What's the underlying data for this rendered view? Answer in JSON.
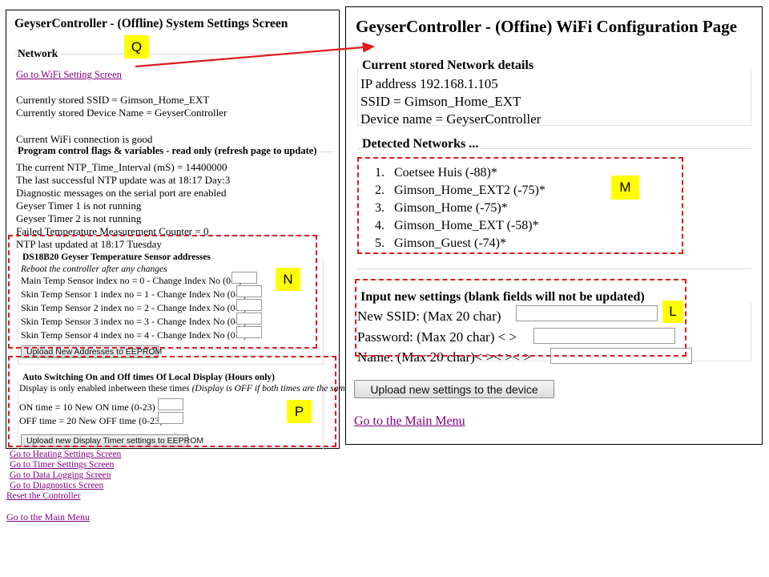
{
  "left_panel": {
    "title": "GeyserController - (Offline) System Settings Screen",
    "network_section": {
      "legend": "Network",
      "wifi_link": "Go to WiFi Setting Screen",
      "stored_ssid": "Currently stored SSID = Gimson_Home_EXT",
      "stored_device_name": "Currently stored Device Name = GeyserController",
      "connection_status": "Current WiFi connection is good"
    },
    "flags_section": {
      "legend": "Program control flags & variables - read only (refresh page to update)",
      "lines": [
        "The current NTP_Time_Interval (mS) = 14400000",
        "The last successful NTP update was at 18:17 Day:3",
        "Diagnostic messages on the serial port are enabled",
        "Geyser Timer 1 is not running",
        "Geyser Timer 2 is not running",
        "Failed Temperature Measurement Counter = 0",
        "NTP last updated at 18:17 Tuesday"
      ]
    },
    "sensor_section": {
      "legend": "DS18B20 Geyser Temperature Sensor addresses",
      "note": "Reboot the controller after any changes",
      "rows": [
        {
          "label": "Main Temp Sensor index no = 0 - Change Index No (0-4)",
          "value": ""
        },
        {
          "label": "Skin Temp Sensor 1 index no = 1 - Change Index No (0-4)",
          "value": ""
        },
        {
          "label": "Skin Temp Sensor 2 index no = 2 - Change Index No (0-4)",
          "value": ""
        },
        {
          "label": "Skin Temp Sensor 3 index no = 3 - Change Index No (0-4)",
          "value": ""
        },
        {
          "label": "Skin Temp Sensor 4 index no = 4 - Change Index No (0-4)",
          "value": ""
        }
      ],
      "upload_button": "Upload New Addresses to EEPROM"
    },
    "display_section": {
      "legend": "Auto Switching On and Off times Of Local Display (Hours only)",
      "note_plain": "Display is only enabled inbetween these times ",
      "note_italic": "(Display is OFF if both times are the same)",
      "on_label": "ON time =  10  New ON time (0-23)",
      "on_value": "",
      "off_label": "OFF time = 20  New OFF time (0-23)",
      "off_value": "",
      "upload_button": "Upload new Display Timer settings to EEPROM"
    },
    "nav_links": [
      "Go to Heating Settings Screen",
      "Go to Timer Settings Screen",
      "Go to Data Logging Screen",
      "Go to Diagnostics Screen",
      "Reset the Controller"
    ],
    "main_menu_link": "Go to the Main Menu"
  },
  "right_panel": {
    "title": "GeyserController - (Offine) WiFi Configuration Page",
    "stored_section": {
      "legend": "Current stored Network details",
      "ip_address": "IP address 192.168.1.105",
      "ssid": "SSID = Gimson_Home_EXT",
      "device_name": "Device name = GeyserController"
    },
    "detected_section": {
      "legend": "Detected Networks ...",
      "networks": [
        {
          "n": "1.",
          "name": "Coetsee Huis (-88)*"
        },
        {
          "n": "2.",
          "name": "Gimson_Home_EXT2 (-75)*"
        },
        {
          "n": "3.",
          "name": "Gimson_Home (-75)*"
        },
        {
          "n": "4.",
          "name": "Gimson_Home_EXT (-58)*"
        },
        {
          "n": "5.",
          "name": "Gimson_Guest (-74)*"
        }
      ]
    },
    "input_section": {
      "legend": "Input new settings (blank fields will not be updated)",
      "ssid_label": "New SSID: (Max 20 char)",
      "ssid_value": "",
      "password_label": "Password: (Max 20 char) < >",
      "password_value": "",
      "name_label": "Name: (Max 20 char)< >< >< >",
      "name_value": "",
      "upload_button": "Upload new settings to the device"
    },
    "main_menu_link": "Go to the Main Menu"
  },
  "annotations": {
    "markers": [
      {
        "id": "Q",
        "label": "Q"
      },
      {
        "id": "N",
        "label": "N"
      },
      {
        "id": "P",
        "label": "P"
      },
      {
        "id": "M",
        "label": "M"
      },
      {
        "id": "L",
        "label": "L"
      }
    ],
    "colors": {
      "marker_bg": "#ffff00",
      "dashed_box": "#d81c1c",
      "arrow": "#e01b1b",
      "link": "#800080"
    }
  }
}
